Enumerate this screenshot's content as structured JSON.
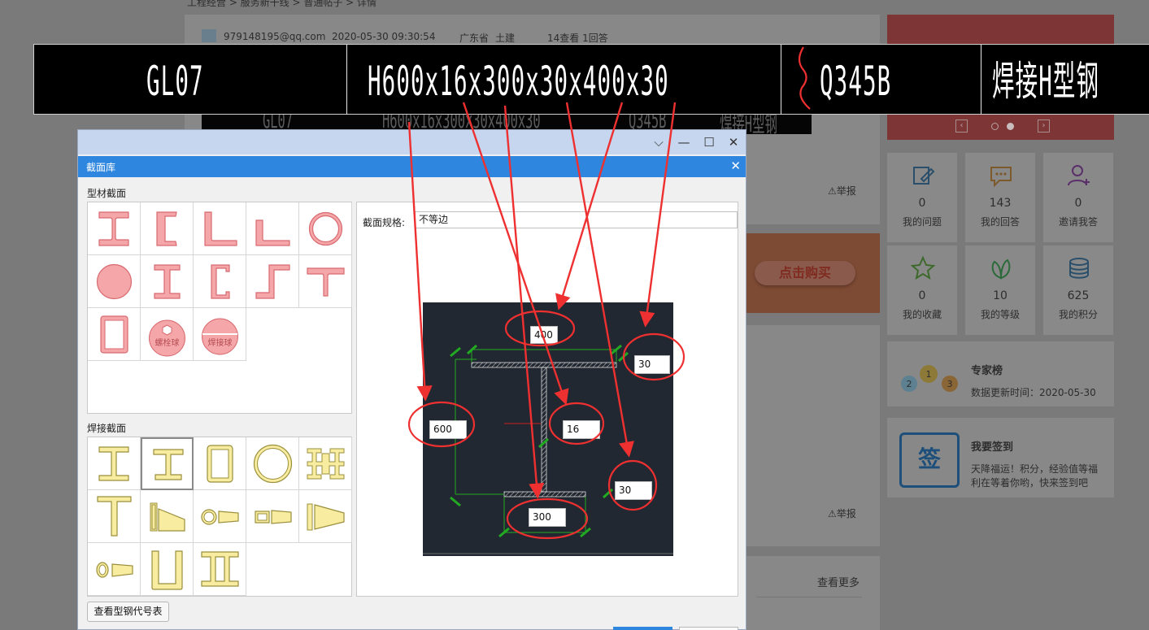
{
  "background": {
    "breadcrumb": "工程经营 > 服务新干线 > 普通帖子 > 详情",
    "question_meta": {
      "email": "979148195@qq.com",
      "datetime": "2020-05-30 09:30:54",
      "region": "广东省",
      "category": "土建",
      "views_answers": "14查看  1回答"
    },
    "report_label": "举报",
    "buy_button": "点击购买",
    "see_more": "查看更多",
    "stats": [
      {
        "icon": "edit-icon",
        "count": "0",
        "label": "我的问题"
      },
      {
        "icon": "chat-icon",
        "count": "143",
        "label": "我的回答"
      },
      {
        "icon": "invite-user-icon",
        "count": "0",
        "label": "邀请我答"
      },
      {
        "icon": "star-icon",
        "count": "0",
        "label": "我的收藏"
      },
      {
        "icon": "leaf-icon",
        "count": "10",
        "label": "我的等级"
      },
      {
        "icon": "coins-icon",
        "count": "625",
        "label": "我的积分"
      }
    ],
    "expert": {
      "title": "专家榜",
      "subtitle": "数据更新时间：2020-05-30"
    },
    "checkin": {
      "title": "我要签到",
      "icon_text": "签",
      "desc_line1": "天降福运！积分，经验值等福",
      "desc_line2": "利在等着你哟，快来签到吧"
    },
    "carousel": {
      "prev": "‹",
      "next": "›"
    }
  },
  "cad_label": {
    "code": "GL07",
    "spec": "H600x16x300x30x400x30",
    "material": "Q345B",
    "type": "焊接H型钢"
  },
  "dialog": {
    "window_controls": {
      "dropdown": "⌵",
      "minimize": "—",
      "maximize": "☐",
      "close": "✕"
    },
    "title": "截面库",
    "close": "✕",
    "section_profiles_title": "型材截面",
    "weld_sections_title": "焊接截面",
    "profile_labels": {
      "bolt_ball": "螺栓球",
      "weld_ball": "焊接球"
    },
    "spec_label": "截面规格:",
    "spec_value": "不等边",
    "dims": {
      "top_flange_width": "400",
      "top_flange_thickness": "30",
      "height": "600",
      "web_thickness": "16",
      "bottom_flange_thickness": "30",
      "bottom_flange_width": "300"
    },
    "steel_table_button": "查看型钢代号表"
  },
  "colors": {
    "profile_fill": "#f4a6a8",
    "profile_stroke": "#d86a70",
    "weld_fill": "#f7ec9f",
    "weld_stroke": "#9a8f3c",
    "annotation": "#ee3030",
    "dim_line": "#22aa22",
    "dialog_header": "#2e86df"
  }
}
